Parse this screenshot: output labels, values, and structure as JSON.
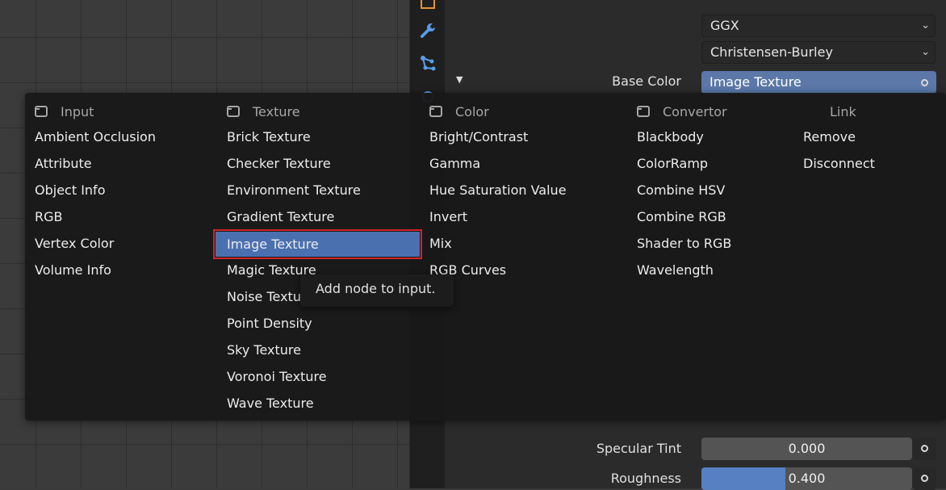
{
  "properties": {
    "distribution": "GGX",
    "subsurface_method": "Christensen-Burley",
    "base_color_label": "Base Color",
    "base_color_link": "Image Texture",
    "specular_tint_label": "Specular Tint",
    "specular_tint_value": "0.000",
    "specular_tint_level": 0.0,
    "roughness_label": "Roughness",
    "roughness_value": "0.400",
    "roughness_level": 0.4
  },
  "menu": {
    "columns": [
      {
        "header": "Input",
        "items": [
          "Ambient Occlusion",
          "Attribute",
          "Object Info",
          "RGB",
          "Vertex Color",
          "Volume Info"
        ]
      },
      {
        "header": "Texture",
        "items": [
          "Brick Texture",
          "Checker Texture",
          "Environment Texture",
          "Gradient Texture",
          "Image Texture",
          "Magic Texture",
          "Noise Texture",
          "Point Density",
          "Sky Texture",
          "Voronoi Texture",
          "Wave Texture"
        ]
      },
      {
        "header": "Color",
        "items": [
          "Bright/Contrast",
          "Gamma",
          "Hue Saturation Value",
          "Invert",
          "Mix",
          "RGB Curves"
        ]
      },
      {
        "header": "Convertor",
        "items": [
          "Blackbody",
          "ColorRamp",
          "Combine HSV",
          "Combine RGB",
          "Shader to RGB",
          "Wavelength"
        ]
      },
      {
        "header": "Link",
        "items": [
          "Remove",
          "Disconnect"
        ]
      }
    ],
    "selected": "Image Texture"
  },
  "tooltip": "Add node to input.",
  "icons": [
    "wrench-icon",
    "particles-icon",
    "dropdown-chevron-icon",
    "socket-icon",
    "node-category-icon"
  ],
  "colors": {
    "accent": "#5680c2",
    "selection": "#4a70b0",
    "highlight_border": "#d2232a"
  }
}
